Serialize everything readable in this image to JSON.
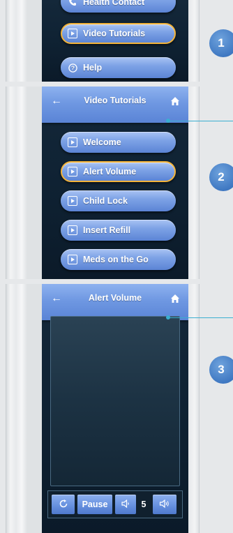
{
  "panel1": {
    "step": "1",
    "buttons": [
      {
        "label": "Health Contact",
        "icon": "phone-icon",
        "selected": false
      },
      {
        "label": "Video Tutorials",
        "icon": "play-icon",
        "selected": true
      },
      {
        "label": "Help",
        "icon": "help-icon",
        "selected": false
      }
    ]
  },
  "panel2": {
    "step": "2",
    "title": "Video Tutorials",
    "buttons": [
      {
        "label": "Welcome",
        "selected": false
      },
      {
        "label": "Alert Volume",
        "selected": true
      },
      {
        "label": "Child Lock",
        "selected": false
      },
      {
        "label": "Insert Refill",
        "selected": false
      },
      {
        "label": "Meds on the Go",
        "selected": false
      }
    ]
  },
  "panel3": {
    "step": "3",
    "title": "Alert Volume",
    "controls": {
      "pause_label": "Pause",
      "volume_value": "5"
    }
  },
  "colors": {
    "accent": "#6f98e2",
    "selected_border": "#f3b43a",
    "badge": "#3f78c2",
    "leader": "#3aaed0"
  }
}
